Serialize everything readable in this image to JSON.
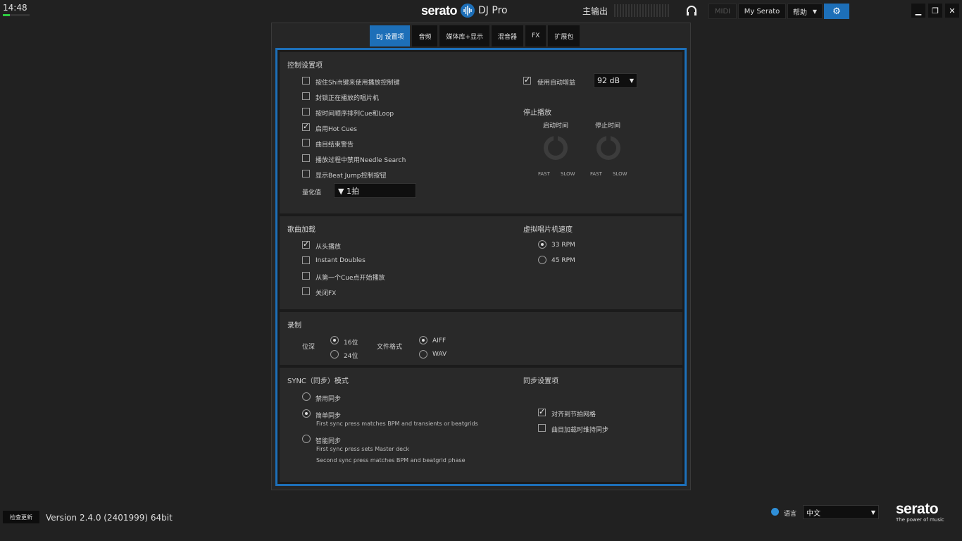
{
  "clock": "14:48",
  "app": {
    "brand": "serato",
    "product": "DJ Pro"
  },
  "top": {
    "master_output": "主输出",
    "midi": "MIDI",
    "my_serato": "My Serato",
    "help": "帮助"
  },
  "tabs": [
    "DJ 设置项",
    "音频",
    "媒体库+显示",
    "混音器",
    "FX",
    "扩展包"
  ],
  "control": {
    "title": "控制设置项",
    "options": [
      {
        "label": "按住Shift键来使用播放控制键",
        "checked": false
      },
      {
        "label": "封锁正在播放的唱片机",
        "checked": false
      },
      {
        "label": "按时间顺序排列Cue和Loop",
        "checked": false
      },
      {
        "label": "启用Hot Cues",
        "checked": true
      },
      {
        "label": "曲目结束警告",
        "checked": false
      },
      {
        "label": "播放过程中禁用Needle Search",
        "checked": false
      },
      {
        "label": "显示Beat Jump控制按钮",
        "checked": false
      }
    ],
    "quantize_label": "量化值",
    "quantize_value": "▼ 1拍",
    "auto_gain_label": "使用自动增益",
    "auto_gain_checked": true,
    "auto_gain_value": "92 dB",
    "stop_title": "停止播放",
    "start_time": "启动时间",
    "stop_time": "停止时间",
    "fast": "FAST",
    "slow": "SLOW"
  },
  "loading": {
    "title": "歌曲加载",
    "options": [
      {
        "label": "从头播放",
        "checked": true
      },
      {
        "label": "Instant Doubles",
        "checked": false
      },
      {
        "label": "从第一个Cue点开始播放",
        "checked": false
      },
      {
        "label": "关闭FX",
        "checked": false
      }
    ],
    "speed_title": "虚拟唱片机速度",
    "speeds": [
      {
        "label": "33 RPM",
        "selected": true
      },
      {
        "label": "45 RPM",
        "selected": false
      }
    ]
  },
  "record": {
    "title": "录制",
    "depth_label": "位深",
    "depths": [
      {
        "label": "16位",
        "selected": true
      },
      {
        "label": "24位",
        "selected": false
      }
    ],
    "format_label": "文件格式",
    "formats": [
      {
        "label": "AIFF",
        "selected": true
      },
      {
        "label": "WAV",
        "selected": false
      }
    ]
  },
  "sync": {
    "title": "SYNC（同步）模式",
    "modes": [
      {
        "label": "禁用同步",
        "selected": false,
        "desc": []
      },
      {
        "label": "简单同步",
        "selected": true,
        "desc": [
          "First sync press matches BPM and transients or beatgrids"
        ]
      },
      {
        "label": "智能同步",
        "selected": false,
        "desc": [
          "First sync press sets Master deck",
          "Second sync press matches BPM and beatgrid phase"
        ]
      }
    ],
    "settings_title": "同步设置项",
    "settings": [
      {
        "label": "对齐到节拍网格",
        "checked": true
      },
      {
        "label": "曲目加载时维持同步",
        "checked": false
      }
    ]
  },
  "footer": {
    "update_button": "检查更新",
    "version": "Version 2.4.0 (2401999) 64bit",
    "language_label": "语言",
    "language_value": "中文",
    "tagline": "The power of music"
  },
  "colors": {
    "accent": "#1d6fb8",
    "background": "#212121"
  }
}
